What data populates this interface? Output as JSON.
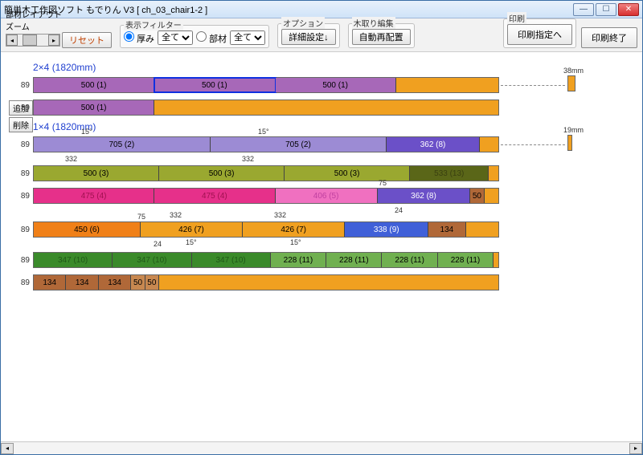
{
  "window": {
    "title": "簡単木工作図ソフト もでりん V3  [ ch_03_chair1-2 ]"
  },
  "toolbar": {
    "layout_label": "部材レイアウト",
    "zoom_label": "ズーム",
    "reset_label": "リセット",
    "filter_label": "表示フィルター",
    "filter_thickness": "厚み",
    "filter_all1": "全て",
    "filter_member": "部材",
    "filter_all2": "全て",
    "option_label": "オプション",
    "option_detail": "詳細設定↓",
    "kidori_label": "木取り編集",
    "kidori_auto": "自動再配置",
    "print_label": "印刷",
    "print_spec": "印刷指定へ",
    "print_end": "印刷終了"
  },
  "side": {
    "add": "追加",
    "del": "削除"
  },
  "sections": {
    "s1": "2×4 (1820mm)",
    "s2": "1×4 (1820mm)"
  },
  "labels": {
    "w89": "89",
    "off38": "38mm",
    "off19": "19mm",
    "d15": "15°",
    "d332": "332",
    "d24": "24",
    "d75": "75"
  },
  "segs": {
    "p500_1": "500 (1)",
    "p705_2": "705 (2)",
    "p362_8": "362 (8)",
    "p500_3": "500 (3)",
    "p475_4": "475 (4)",
    "p406_5": "406 (5)",
    "p50": "50",
    "p450_6": "450 (6)",
    "p426_7": "426 (7)",
    "p338_9": "338 (9)",
    "p134": "134",
    "p228_11": "228 (11)",
    "p347_10": "347 (10)",
    "p533_13": "533 (13)"
  },
  "colors": {
    "purple": "#a768b8",
    "lilac": "#9c8bd4",
    "violet": "#6b50c8",
    "orange": "#f0a020",
    "olive": "#9aa830",
    "darkolive": "#5a6618",
    "magenta": "#e6308a",
    "pink": "#f070c0",
    "blue": "#4060d8",
    "green": "#3a8a2a",
    "lightgreen": "#70b050",
    "brown": "#b06838",
    "tan": "#c88850"
  }
}
